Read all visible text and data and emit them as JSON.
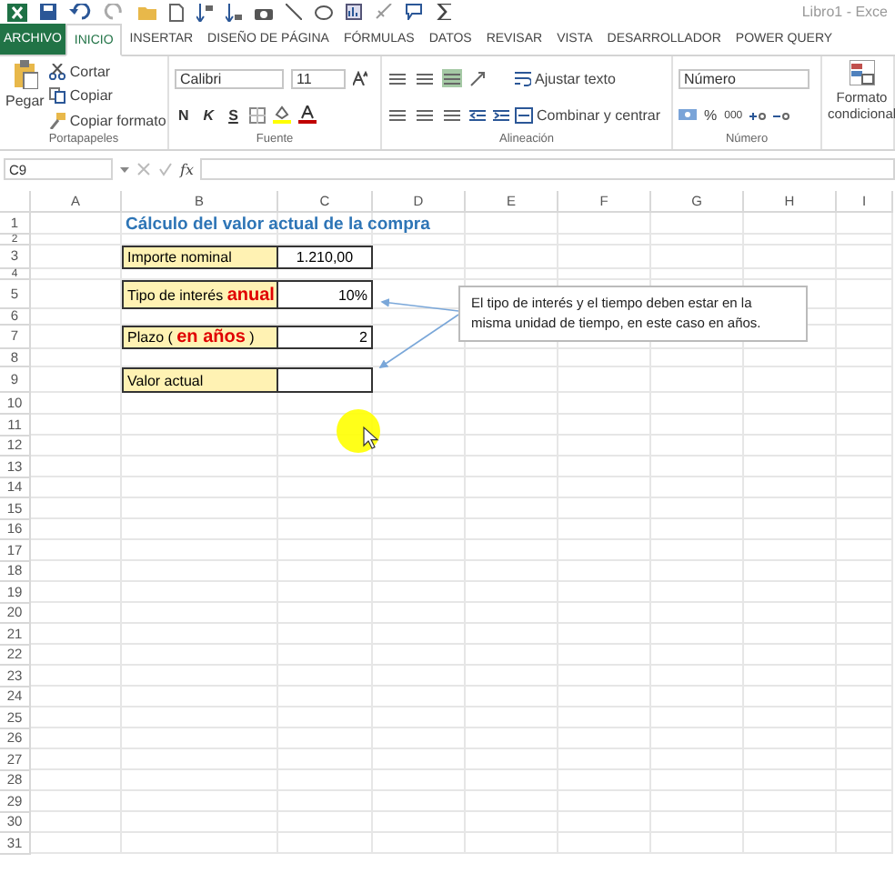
{
  "window": {
    "title": "Libro1 - Exce"
  },
  "ribbon_tabs": [
    {
      "label": "ARCHIVO",
      "kind": "file",
      "selected": false
    },
    {
      "label": "INICIO",
      "kind": "tab",
      "selected": true
    },
    {
      "label": "INSERTAR",
      "kind": "tab",
      "selected": false
    },
    {
      "label": "DISEÑO DE PÁGINA",
      "kind": "tab",
      "selected": false
    },
    {
      "label": "FÓRMULAS",
      "kind": "tab",
      "selected": false
    },
    {
      "label": "DATOS",
      "kind": "tab",
      "selected": false
    },
    {
      "label": "REVISAR",
      "kind": "tab",
      "selected": false
    },
    {
      "label": "VISTA",
      "kind": "tab",
      "selected": false
    },
    {
      "label": "DESARROLLADOR",
      "kind": "tab",
      "selected": false
    },
    {
      "label": "POWER QUERY",
      "kind": "tab",
      "selected": false
    }
  ],
  "ribbon": {
    "clipboard": {
      "paste": "Pegar",
      "cut": "Cortar",
      "copy": "Copiar",
      "format_painter": "Copiar formato",
      "group": "Portapapeles"
    },
    "font": {
      "name": "Calibri",
      "size": "11",
      "bold": "N",
      "italic": "K",
      "underline": "S",
      "group": "Fuente"
    },
    "alignment": {
      "wrap": "Ajustar texto",
      "merge": "Combinar y centrar",
      "group": "Alineación"
    },
    "number": {
      "format": "Número",
      "percent": "%",
      "thousands": "000",
      "group": "Número"
    },
    "styles": {
      "conditional": "Formato condicional"
    }
  },
  "formula_bar": {
    "name_box": "C9",
    "fx": "fx"
  },
  "sheet": {
    "columns": [
      "A",
      "B",
      "C",
      "D",
      "E",
      "F",
      "G",
      "H",
      "I"
    ],
    "rows": [
      "1",
      "2",
      "3",
      "4",
      "5",
      "6",
      "7",
      "8",
      "9",
      "10",
      "11",
      "12",
      "13",
      "14",
      "15",
      "16",
      "17",
      "18",
      "19",
      "20",
      "21",
      "22",
      "23",
      "24",
      "25",
      "26",
      "27",
      "28",
      "29",
      "30",
      "31"
    ],
    "title": "Cálculo del valor actual de la compra",
    "inputs": [
      {
        "label": "Importe nominal",
        "value": "1.210,00"
      },
      {
        "label": "Tipo de interés **anual**",
        "value": "10%"
      },
      {
        "label": "Plazo ( **en años** )",
        "value": "2"
      },
      {
        "label": "Valor actual"
      }
    ]
  },
  "callout": {
    "text": "El tipo de interés y el tiempo deben estar en la misma unidad de tiempo, en este caso en años."
  }
}
